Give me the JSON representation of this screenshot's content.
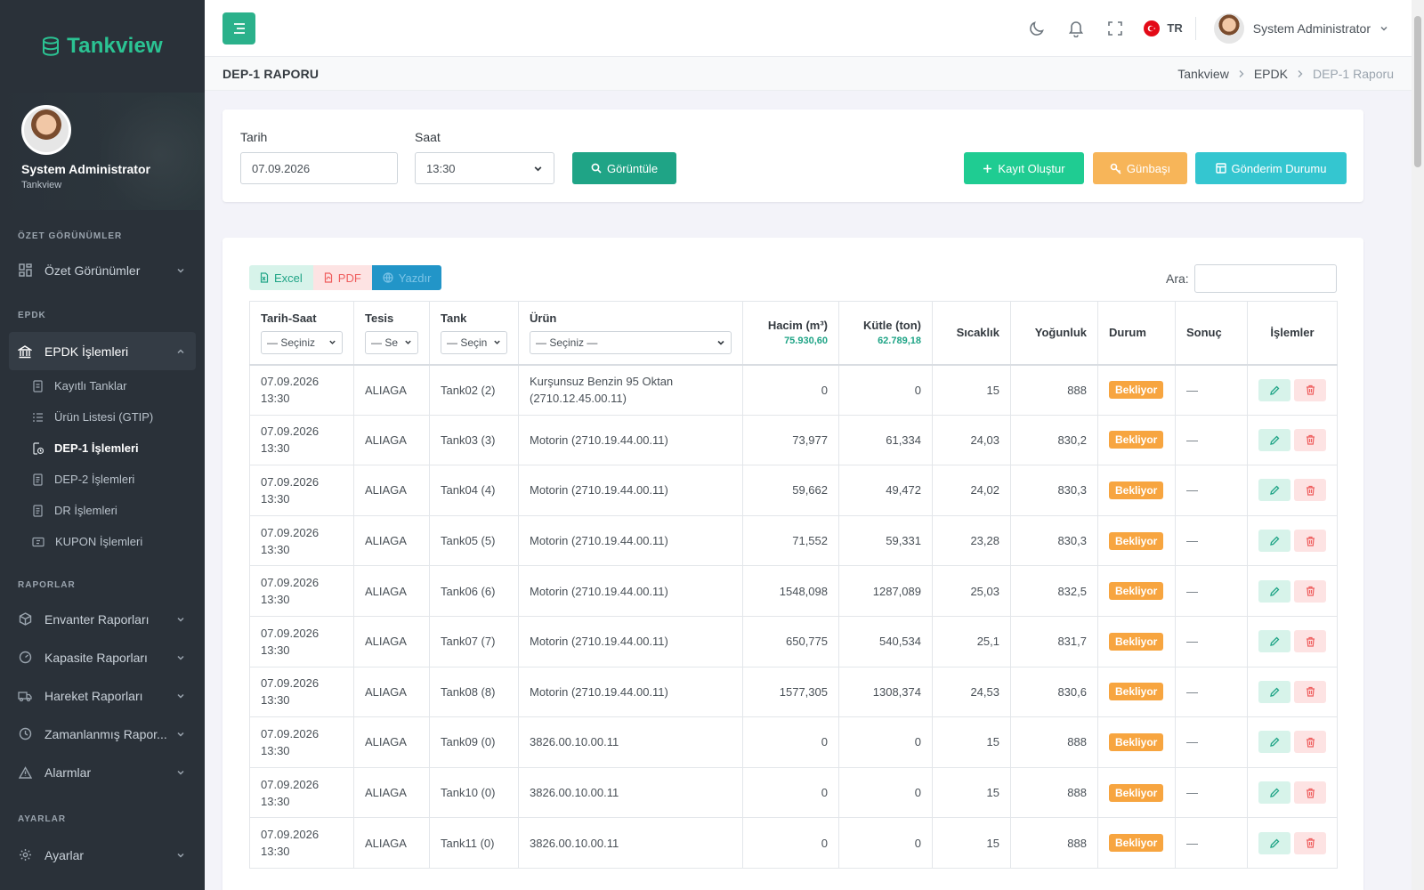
{
  "brand": {
    "name": "Tankview"
  },
  "profile": {
    "name": "System Administrator",
    "org": "Tankview"
  },
  "sidebar": {
    "sections": {
      "ozet": "ÖZET GÖRÜNÜMLER",
      "epdk": "EPDK",
      "raporlar": "RAPORLAR",
      "ayarlar": "AYARLAR"
    },
    "ozet_menu": "Özet Görünümler",
    "epdk_menu": "EPDK İşlemleri",
    "epdk_sub": [
      "Kayıtlı Tanklar",
      "Ürün Listesi (GTIP)",
      "DEP-1 İşlemleri",
      "DEP-2 İşlemleri",
      "DR İşlemleri",
      "KUPON İşlemleri"
    ],
    "raporlar_menu": [
      "Envanter Raporları",
      "Kapasite Raporları",
      "Hareket Raporları",
      "Zamanlanmış Rapor...",
      "Alarmlar"
    ],
    "ayarlar_menu": "Ayarlar"
  },
  "topbar": {
    "lang": "TR",
    "user": "System Administrator"
  },
  "page": {
    "title": "DEP-1 RAPORU",
    "breadcrumb": [
      "Tankview",
      "EPDK",
      "DEP-1 Raporu"
    ]
  },
  "filters": {
    "date_label": "Tarih",
    "date_value": "07.09.2026",
    "time_label": "Saat",
    "time_value": "13:30",
    "view_button": "Görüntüle",
    "create_button": "Kayıt Oluştur",
    "gunbasi_button": "Günbaşı",
    "send_button": "Gönderim Durumu"
  },
  "table_tools": {
    "excel": "Excel",
    "pdf": "PDF",
    "print": "Yazdır",
    "search_label": "Ara:"
  },
  "table": {
    "headers": {
      "datetime": "Tarih-Saat",
      "tesis": "Tesis",
      "tank": "Tank",
      "urun": "Ürün",
      "hacim": "Hacim (m³)",
      "kutle": "Kütle (ton)",
      "sicaklik": "Sıcaklık",
      "yogunluk": "Yoğunluk",
      "durum": "Durum",
      "sonuc": "Sonuç",
      "islemler": "İşlemler"
    },
    "filters": {
      "datetime": "— Seçiniz",
      "tesis": "— Se",
      "tank": "— Seçin",
      "urun": "— Seçiniz —"
    },
    "totals": {
      "hacim": "75.930,60",
      "kutle": "62.789,18"
    },
    "rows": [
      {
        "date": "07.09.2026",
        "time": "13:30",
        "tesis": "ALIAGA",
        "tank": "Tank02 (2)",
        "urun1": "Kurşunsuz Benzin 95 Oktan",
        "urun2": "(2710.12.45.00.11)",
        "hacim": "0",
        "kutle": "0",
        "sicaklik": "15",
        "yogunluk": "888",
        "durum": "Bekliyor",
        "sonuc": "—"
      },
      {
        "date": "07.09.2026",
        "time": "13:30",
        "tesis": "ALIAGA",
        "tank": "Tank03 (3)",
        "urun1": "Motorin (2710.19.44.00.11)",
        "urun2": "",
        "hacim": "73,977",
        "kutle": "61,334",
        "sicaklik": "24,03",
        "yogunluk": "830,2",
        "durum": "Bekliyor",
        "sonuc": "—"
      },
      {
        "date": "07.09.2026",
        "time": "13:30",
        "tesis": "ALIAGA",
        "tank": "Tank04 (4)",
        "urun1": "Motorin (2710.19.44.00.11)",
        "urun2": "",
        "hacim": "59,662",
        "kutle": "49,472",
        "sicaklik": "24,02",
        "yogunluk": "830,3",
        "durum": "Bekliyor",
        "sonuc": "—"
      },
      {
        "date": "07.09.2026",
        "time": "13:30",
        "tesis": "ALIAGA",
        "tank": "Tank05 (5)",
        "urun1": "Motorin (2710.19.44.00.11)",
        "urun2": "",
        "hacim": "71,552",
        "kutle": "59,331",
        "sicaklik": "23,28",
        "yogunluk": "830,3",
        "durum": "Bekliyor",
        "sonuc": "—"
      },
      {
        "date": "07.09.2026",
        "time": "13:30",
        "tesis": "ALIAGA",
        "tank": "Tank06 (6)",
        "urun1": "Motorin (2710.19.44.00.11)",
        "urun2": "",
        "hacim": "1548,098",
        "kutle": "1287,089",
        "sicaklik": "25,03",
        "yogunluk": "832,5",
        "durum": "Bekliyor",
        "sonuc": "—"
      },
      {
        "date": "07.09.2026",
        "time": "13:30",
        "tesis": "ALIAGA",
        "tank": "Tank07 (7)",
        "urun1": "Motorin (2710.19.44.00.11)",
        "urun2": "",
        "hacim": "650,775",
        "kutle": "540,534",
        "sicaklik": "25,1",
        "yogunluk": "831,7",
        "durum": "Bekliyor",
        "sonuc": "—"
      },
      {
        "date": "07.09.2026",
        "time": "13:30",
        "tesis": "ALIAGA",
        "tank": "Tank08 (8)",
        "urun1": "Motorin (2710.19.44.00.11)",
        "urun2": "",
        "hacim": "1577,305",
        "kutle": "1308,374",
        "sicaklik": "24,53",
        "yogunluk": "830,6",
        "durum": "Bekliyor",
        "sonuc": "—"
      },
      {
        "date": "07.09.2026",
        "time": "13:30",
        "tesis": "ALIAGA",
        "tank": "Tank09 (0)",
        "urun1": "3826.00.10.00.11",
        "urun2": "",
        "hacim": "0",
        "kutle": "0",
        "sicaklik": "15",
        "yogunluk": "888",
        "durum": "Bekliyor",
        "sonuc": "—"
      },
      {
        "date": "07.09.2026",
        "time": "13:30",
        "tesis": "ALIAGA",
        "tank": "Tank10 (0)",
        "urun1": "3826.00.10.00.11",
        "urun2": "",
        "hacim": "0",
        "kutle": "0",
        "sicaklik": "15",
        "yogunluk": "888",
        "durum": "Bekliyor",
        "sonuc": "—"
      },
      {
        "date": "07.09.2026",
        "time": "13:30",
        "tesis": "ALIAGA",
        "tank": "Tank11 (0)",
        "urun1": "3826.00.10.00.11",
        "urun2": "",
        "hacim": "0",
        "kutle": "0",
        "sicaklik": "15",
        "yogunluk": "888",
        "durum": "Bekliyor",
        "sonuc": "—"
      }
    ]
  },
  "colors": {
    "brand": "#2bc393",
    "sidebar_bg": "#2a3139",
    "primary": "#1fa486",
    "warning_badge": "#f7a540"
  },
  "icons": {
    "brand": "database-icon",
    "menu_toggle": "hamburger-icon",
    "theme": "moon-icon",
    "notifications": "bell-icon",
    "fullscreen": "fullscreen-icon",
    "language": "turkey-flag-icon",
    "row_edit": "pencil-icon",
    "row_delete": "trash-icon"
  }
}
